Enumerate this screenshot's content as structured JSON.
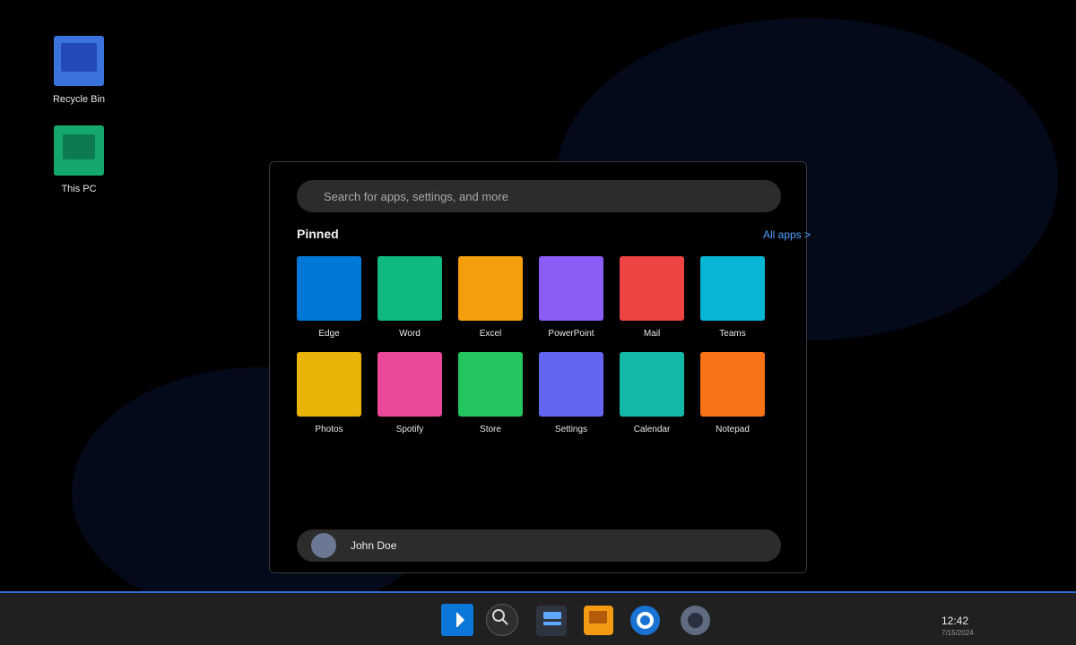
{
  "desktop": {
    "icons": [
      {
        "label": "Recycle Bin",
        "icon": "recycle-bin-icon",
        "color": "#3a73db"
      },
      {
        "label": "This PC",
        "icon": "this-pc-icon",
        "color": "#14a86c"
      }
    ]
  },
  "start_menu": {
    "search_placeholder": "Search for apps, settings, and more",
    "pinned_title": "Pinned",
    "all_apps_label": "All apps >",
    "apps": [
      {
        "label": "Edge",
        "color": "#0078d7"
      },
      {
        "label": "Word",
        "color": "#10b981"
      },
      {
        "label": "Excel",
        "color": "#f59e0b"
      },
      {
        "label": "PowerPoint",
        "color": "#8b5cf6"
      },
      {
        "label": "Mail",
        "color": "#ef4444"
      },
      {
        "label": "Teams",
        "color": "#06b6d4"
      },
      {
        "label": "Photos",
        "color": "#eab308"
      },
      {
        "label": "Spotify",
        "color": "#ec4899"
      },
      {
        "label": "Store",
        "color": "#22c55e"
      },
      {
        "label": "Settings",
        "color": "#6366f1"
      },
      {
        "label": "Calendar",
        "color": "#14b8a6"
      },
      {
        "label": "Notepad",
        "color": "#f97316"
      }
    ],
    "user": {
      "name": "John Doe",
      "avatar_color": "#6b7894"
    }
  },
  "taskbar": {
    "buttons": [
      {
        "icon": "start-icon"
      },
      {
        "icon": "search-icon"
      },
      {
        "icon": "file-explorer-icon"
      },
      {
        "icon": "store-icon"
      },
      {
        "icon": "browser-icon"
      },
      {
        "icon": "settings-icon"
      }
    ],
    "time": "12:42",
    "date": "7/15/2024",
    "accent": "#2d6fd6"
  }
}
